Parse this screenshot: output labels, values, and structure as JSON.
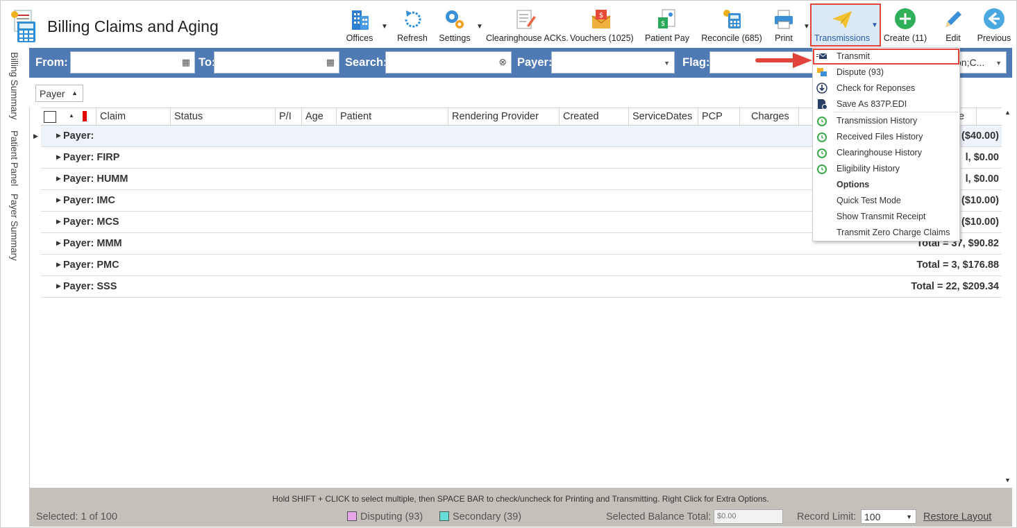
{
  "app": {
    "title": "Billing Claims and Aging"
  },
  "toolbar": {
    "offices": "Offices",
    "refresh": "Refresh",
    "settings": "Settings",
    "clearinghouse": "Clearinghouse ACKs.",
    "vouchers": "Vouchers (1025)",
    "patient_pay": "Patient Pay",
    "reconcile": "Reconcile (685)",
    "print": "Print",
    "transmissions": "Transmissions",
    "create": "Create (11)",
    "edit": "Edit",
    "previous": "Previous"
  },
  "filters": {
    "from": "From:",
    "to": "To:",
    "search": "Search:",
    "payer": "Payer:",
    "flag": "Flag:",
    "flag_tail": "on;C..."
  },
  "side_tabs": [
    "Billing Summary",
    "Patient Panel",
    "Payer Summary"
  ],
  "group_chip": "Payer",
  "grid": {
    "columns": [
      "Claim",
      "Status",
      "P/I",
      "Age",
      "Patient",
      "Rendering Provider",
      "Created",
      "ServiceDates",
      "PCP",
      "Charges",
      "e"
    ],
    "groups": [
      {
        "name": "Payer:",
        "total": "($40.00)"
      },
      {
        "name": "Payer: FIRP",
        "total": "l,  $0.00"
      },
      {
        "name": "Payer: HUMM",
        "total": "l,  $0.00"
      },
      {
        "name": "Payer: IMC",
        "total": "($10.00)"
      },
      {
        "name": "Payer: MCS",
        "total": "($10.00)"
      },
      {
        "name": "Payer: MMM",
        "total": "Total = 37,  $90.82"
      },
      {
        "name": "Payer: PMC",
        "total": "Total = 3,  $176.88"
      },
      {
        "name": "Payer: SSS",
        "total": "Total = 22,  $209.34"
      }
    ]
  },
  "footer": {
    "hint": "Hold SHIFT + CLICK to select multiple, then SPACE BAR to check/uncheck for Printing and Transmitting. Right Click for Extra Options.",
    "selected": "Selected: 1 of 100",
    "disputing": "Disputing (93)",
    "secondary": "Secondary (39)",
    "balance_label": "Selected Balance Total:",
    "balance_value": "$0.00",
    "record_limit_label": "Record Limit:",
    "record_limit_value": "100",
    "restore_layout": "Restore Layout",
    "disputing_color": "#e8a6e8",
    "secondary_color": "#66dcd6"
  },
  "menu": {
    "items": [
      "Transmit",
      "Dispute (93)",
      "Check for Reponses",
      "Save As 837P.EDI",
      "Transmission History",
      "Received Files History",
      "Clearinghouse History",
      "Eligibility History",
      "Options",
      "Quick Test Mode",
      "Show Transmit Receipt",
      "Transmit Zero Charge Claims"
    ]
  },
  "colors": {
    "accent": "#4f7ab3",
    "highlight": "#e0443a",
    "footer": "#c4c0ba"
  }
}
